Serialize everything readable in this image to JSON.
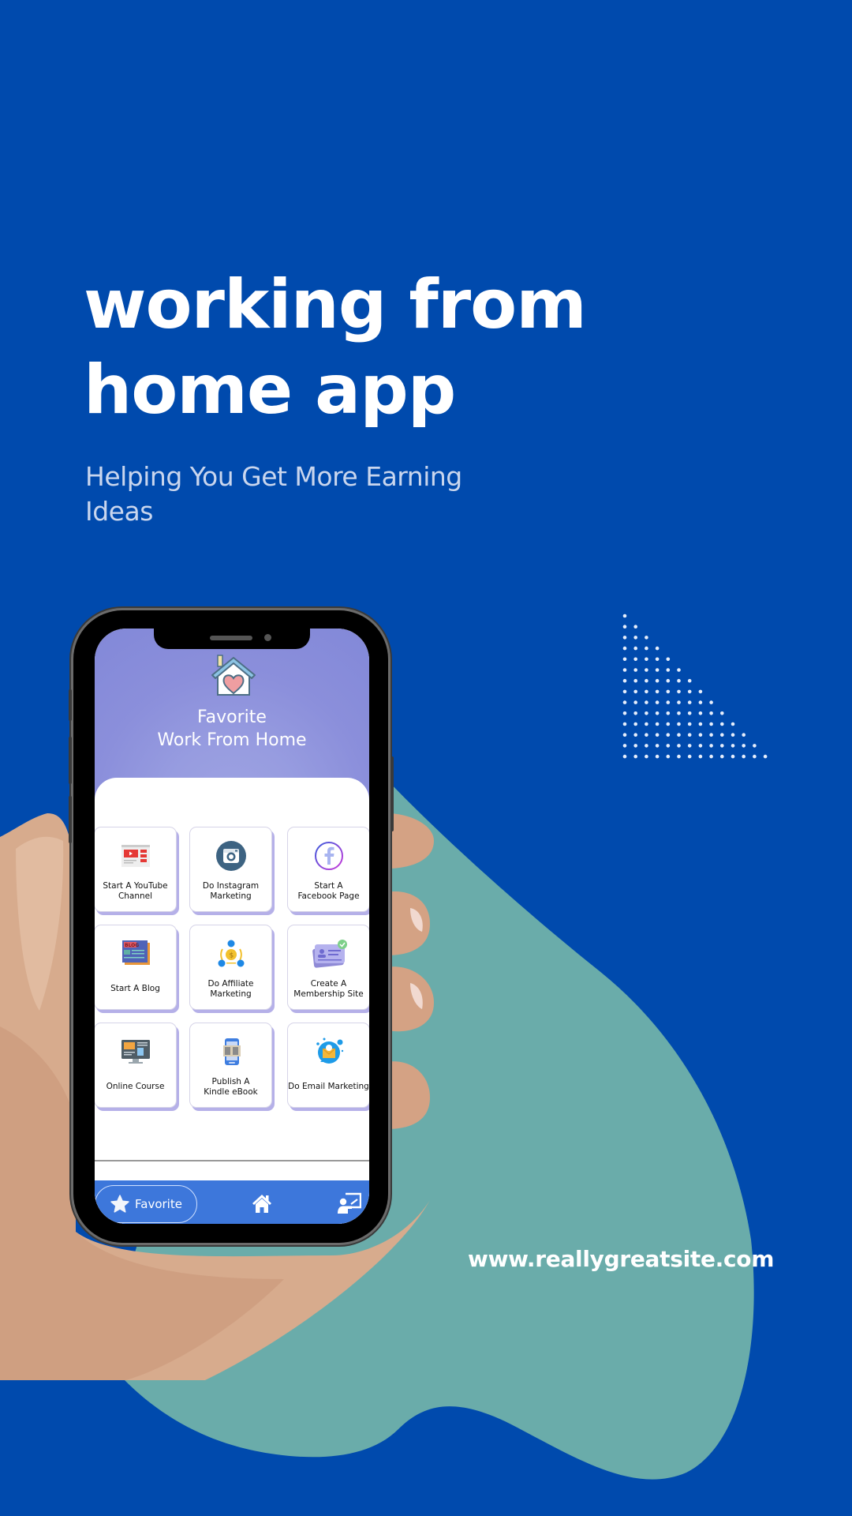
{
  "poster": {
    "headline": "working from home app",
    "headline_line1": "working from",
    "headline_line2": "home app",
    "subtitle_line1": "Helping You Get More Earning",
    "subtitle_line2": "Ideas",
    "website": "www.reallygreatsite.com",
    "colors": {
      "background": "#004aad",
      "blob": "#6aacaa",
      "dots": "#e6eefc",
      "app_header": "#8b8fdb",
      "navbar": "#3d77db",
      "card_shadow": "#b5b0e8"
    },
    "decoration": {
      "dot_triangle_rows": 14
    }
  },
  "app": {
    "header_icon": "house-heart-icon",
    "title_line1": "Favorite",
    "title_line2": "Work From Home",
    "cards": [
      {
        "label_line1": "Start A YouTube",
        "label_line2": "Channel",
        "icon": "youtube-channel-icon"
      },
      {
        "label_line1": "Do Instagram",
        "label_line2": "Marketing",
        "icon": "instagram-icon"
      },
      {
        "label_line1": "Start A",
        "label_line2": "Facebook Page",
        "icon": "facebook-icon"
      },
      {
        "label_line1": "Start A Blog",
        "label_line2": "",
        "icon": "blog-icon"
      },
      {
        "label_line1": "Do Affiliate",
        "label_line2": "Marketing",
        "icon": "affiliate-icon"
      },
      {
        "label_line1": "Create A",
        "label_line2": "Membership Site",
        "icon": "membership-card-icon"
      },
      {
        "label_line1": "Online Course",
        "label_line2": "",
        "icon": "online-course-icon"
      },
      {
        "label_line1": "Publish A",
        "label_line2": "Kindle eBook",
        "icon": "ebook-icon"
      },
      {
        "label_line1": "Do Email Marketing",
        "label_line2": "",
        "icon": "email-marketing-icon"
      }
    ],
    "nav": {
      "favorite_label": "Favorite",
      "favorite_icon": "star-icon",
      "home_icon": "home-icon",
      "teacher_icon": "teacher-board-icon"
    }
  }
}
